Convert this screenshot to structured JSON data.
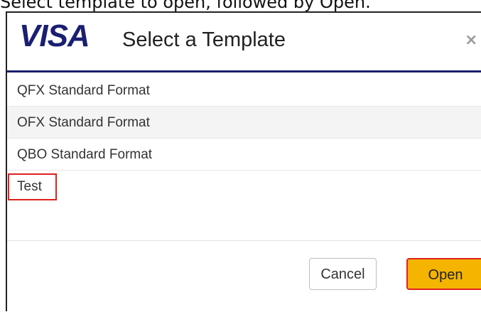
{
  "instruction": "Select template to open, followed by Open.",
  "dialog": {
    "logo": "VISA",
    "title": "Select a Template",
    "close_glyph": "×",
    "templates": [
      "QFX Standard Format",
      "OFX Standard Format",
      "QBO Standard Format",
      "Test"
    ],
    "highlighted_template": "Test",
    "buttons": {
      "cancel_label": "Cancel",
      "open_label": "Open"
    }
  },
  "colors": {
    "visa_blue": "#1a1f71",
    "header_rule": "#1b1f6b",
    "open_button": "#f4b400",
    "highlight_box": "#e02020"
  },
  "icons": {
    "close": "close-icon"
  }
}
